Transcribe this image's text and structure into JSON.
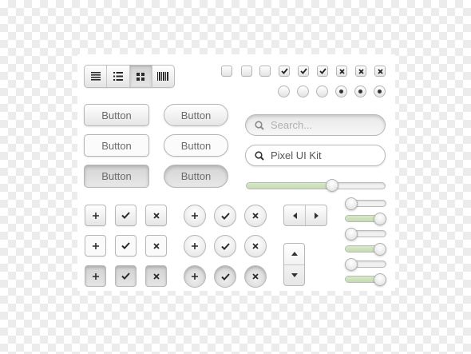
{
  "view_switcher": {
    "options": [
      {
        "icon": "detail-list-icon",
        "selected": false
      },
      {
        "icon": "bullet-list-icon",
        "selected": false
      },
      {
        "icon": "grid-icon",
        "selected": true
      },
      {
        "icon": "barcode-icon",
        "selected": false
      }
    ]
  },
  "buttons": {
    "rect_normal": "Button",
    "rect_flat": "Button",
    "rect_pressed": "Button",
    "pill_normal": "Button",
    "pill_flat": "Button",
    "pill_pressed": "Button"
  },
  "search_empty": {
    "placeholder": "Search..."
  },
  "search_filled": {
    "value": "Pixel UI Kit"
  },
  "slider_main": {
    "value_fraction": 0.63
  },
  "mini_sliders": [
    {
      "value_fraction": 0.0
    },
    {
      "value_fraction": 1.0
    },
    {
      "value_fraction": 0.0
    },
    {
      "value_fraction": 1.0
    },
    {
      "value_fraction": 0.0
    },
    {
      "value_fraction": 1.0
    }
  ],
  "checkboxes": [
    {
      "state": "unchecked"
    },
    {
      "state": "unchecked"
    },
    {
      "state": "unchecked"
    },
    {
      "state": "checked"
    },
    {
      "state": "checked"
    },
    {
      "state": "checked"
    },
    {
      "state": "crossed"
    },
    {
      "state": "crossed"
    },
    {
      "state": "crossed"
    }
  ],
  "radios": [
    {
      "state": "off"
    },
    {
      "state": "off"
    },
    {
      "state": "off"
    },
    {
      "state": "on"
    },
    {
      "state": "on"
    },
    {
      "state": "on"
    }
  ],
  "icon_button_icons": [
    "plus-icon",
    "check-icon",
    "cross-icon"
  ],
  "colors": {
    "accent_fill": "#c9dfb7",
    "text": "#6c6c6c"
  }
}
